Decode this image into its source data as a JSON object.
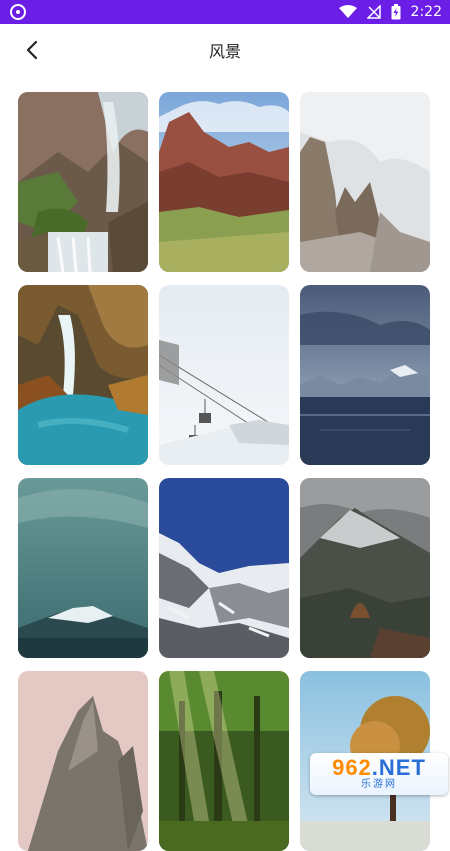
{
  "status_bar": {
    "time": "2:22",
    "icons": [
      "app-icon",
      "wifi-icon",
      "signal-off-icon",
      "battery-charging-icon"
    ],
    "bg_color": "#6a1ee6"
  },
  "header": {
    "title": "风景",
    "back_icon": "chevron-left-icon"
  },
  "wallpapers": [
    {
      "label": "waterfall-canyon"
    },
    {
      "label": "red-rock-valley"
    },
    {
      "label": "misty-cliffs"
    },
    {
      "label": "turquoise-waterfall"
    },
    {
      "label": "ski-lift-snow"
    },
    {
      "label": "mountain-lake-dusk"
    },
    {
      "label": "teal-sky-peak"
    },
    {
      "label": "snowy-ridge-blue-sky"
    },
    {
      "label": "cloudy-mountain"
    },
    {
      "label": "pink-rock-spire"
    },
    {
      "label": "forest-sunbeams"
    },
    {
      "label": "autumn-tree"
    }
  ],
  "watermark": {
    "main": "962",
    "suffix": ".NET",
    "sub": "乐游网"
  }
}
